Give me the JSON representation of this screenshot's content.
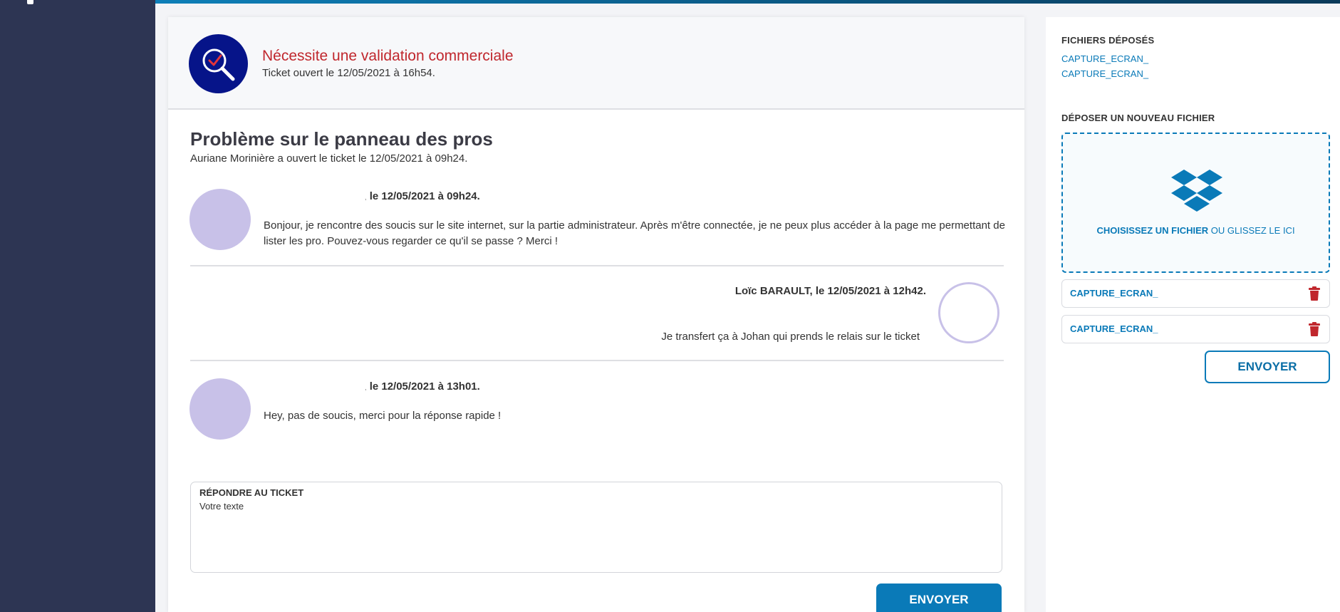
{
  "colors": {
    "sidebar": "#2d3553",
    "accent": "#0a7ab8",
    "alert": "#c0272d",
    "avatar": "#c8c1e8",
    "status_icon_bg": "#061489"
  },
  "status": {
    "title": "Nécessite une validation commerciale",
    "opened": "Ticket ouvert le 12/05/2021 à 16h54.",
    "icon": "magnifier-check-icon"
  },
  "ticket": {
    "title": "Problème sur le panneau des pros",
    "subtitle": "Auriane Morinière a ouvert le ticket le 12/05/2021 à 09h24."
  },
  "messages": [
    {
      "author_prefix": ",",
      "author": "le 12/05/2021 à 09h24.",
      "text": "Bonjour, je rencontre des soucis sur le site internet, sur la partie administrateur. Après m'être connectée, je ne peux plus accéder à la page me permettant de lister les pro. Pouvez-vous regarder ce qu'il se passe ? Merci !"
    },
    {
      "author": "Loïc BARAULT, le 12/05/2021 à 12h42.",
      "text": "Je transfert ça à Johan qui prends le relais sur le ticket"
    },
    {
      "author_prefix": ",",
      "author": "le 12/05/2021 à 13h01.",
      "text": "Hey, pas de soucis, merci pour la réponse rapide !"
    }
  ],
  "reply": {
    "label": "RÉPONDRE AU TICKET",
    "placeholder": "Votre texte",
    "submit_label": "ENVOYER"
  },
  "files": {
    "deposited_heading": "FICHIERS DÉPOSÉS",
    "deposited": [
      "CAPTURE_ECRAN_",
      "CAPTURE_ECRAN_"
    ],
    "upload_heading": "DÉPOSER UN NOUVEAU FICHIER",
    "dropzone_choose": "CHOISISSEZ UN FICHIER",
    "dropzone_rest": " OU GLISSEZ LE ICI",
    "dropzone_icon": "dropbox-icon",
    "pending": [
      "CAPTURE_ECRAN_",
      "CAPTURE_ECRAN_"
    ],
    "submit_label": "ENVOYER"
  }
}
